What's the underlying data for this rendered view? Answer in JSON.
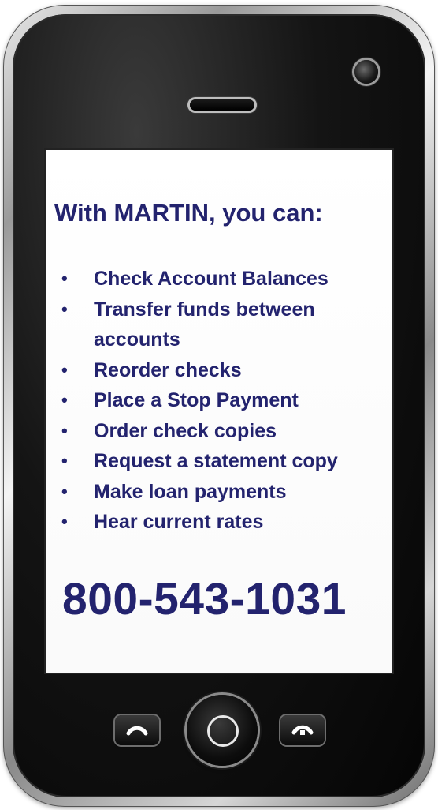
{
  "screen": {
    "headline": "With MARTIN, you can:",
    "features": [
      "Check Account Balances",
      "Transfer funds between accounts",
      "Reorder checks",
      "Place a Stop Payment",
      "Order check copies",
      "Request a statement copy",
      "Make loan payments",
      "Hear current rates"
    ],
    "bullet": "•",
    "phone_number": "800-543-1031"
  },
  "hardware": {
    "icons": {
      "camera": "camera-lens-icon",
      "speaker": "earpiece-speaker-icon",
      "call": "phone-call-icon",
      "home": "home-ring-icon",
      "end": "phone-hangup-icon"
    }
  },
  "colors": {
    "text": "#23236e",
    "screen_bg": "#ffffff",
    "phone_body": "#0a0a0a",
    "phone_bezel": "#b5b5b5"
  }
}
